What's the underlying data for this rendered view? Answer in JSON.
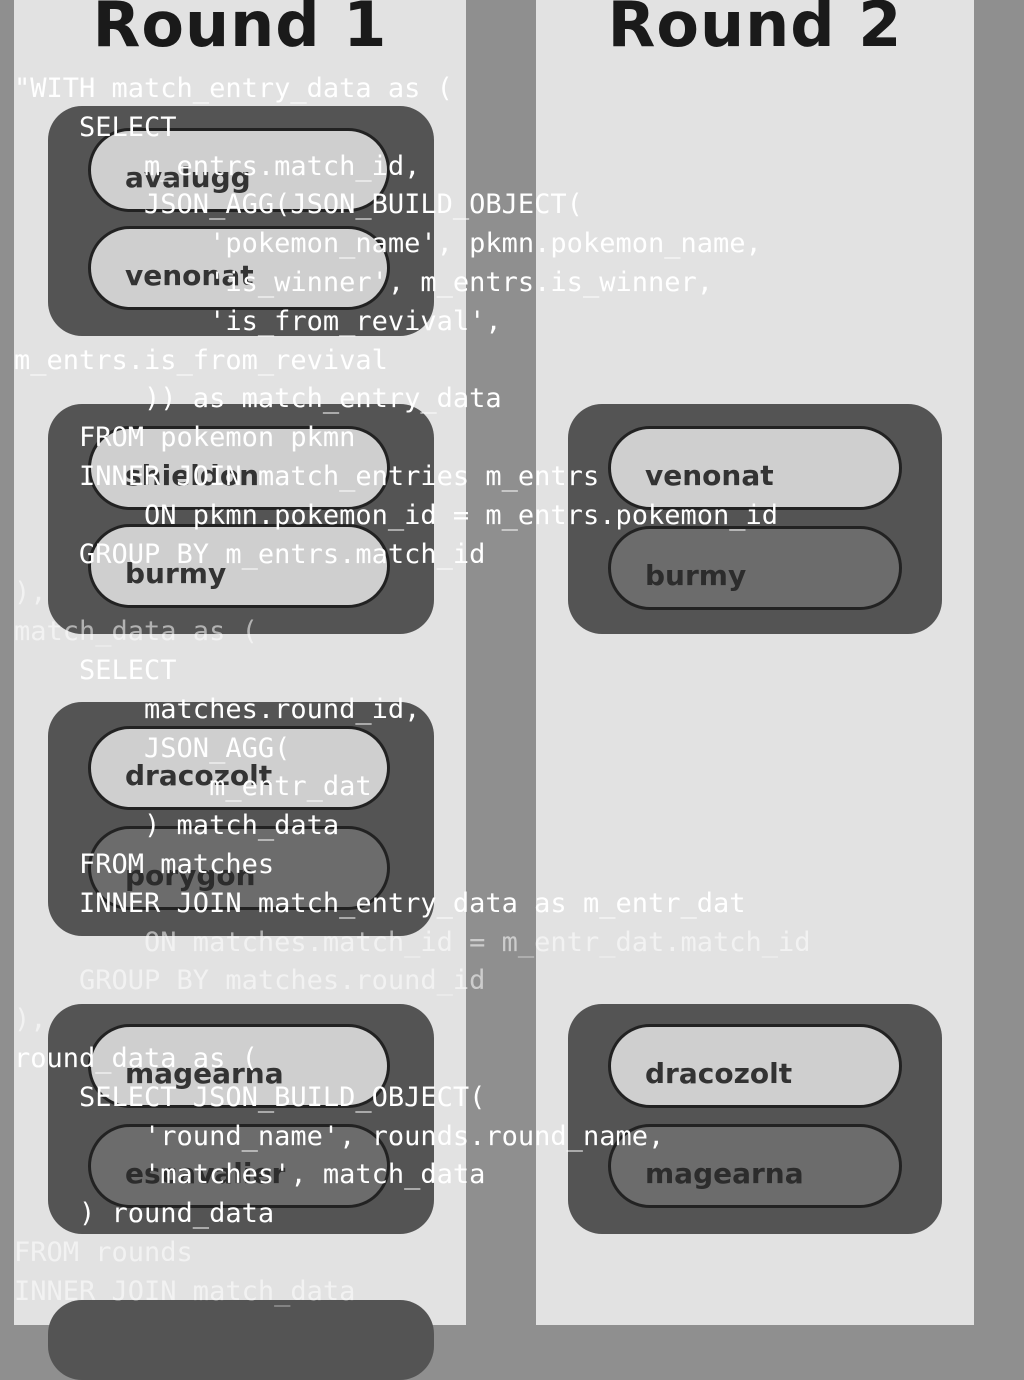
{
  "rounds": [
    {
      "title": "Round 1",
      "matches": [
        {
          "entries": [
            {
              "name": "avalugg",
              "result": "winner"
            },
            {
              "name": "venonat",
              "result": "winner"
            }
          ]
        },
        {
          "entries": [
            {
              "name": "shieldon",
              "result": "winner"
            },
            {
              "name": "burmy",
              "result": "winner"
            }
          ]
        },
        {
          "entries": [
            {
              "name": "dracozolt",
              "result": "winner"
            },
            {
              "name": "porygon",
              "result": "loser"
            }
          ]
        },
        {
          "entries": [
            {
              "name": "magearna",
              "result": "winner"
            },
            {
              "name": "escavalier",
              "result": "loser"
            }
          ]
        }
      ]
    },
    {
      "title": "Round 2",
      "matches": [
        {
          "entries": [
            {
              "name": "venonat",
              "result": "winner"
            },
            {
              "name": "burmy",
              "result": "loser"
            }
          ]
        },
        {
          "entries": [
            {
              "name": "dracozolt",
              "result": "winner"
            },
            {
              "name": "magearna",
              "result": "loser"
            }
          ]
        }
      ]
    }
  ],
  "sql_overlay": [
    "\"WITH match_entry_data as (",
    "    SELECT",
    "        m_entrs.match_id,",
    "        JSON_AGG(JSON_BUILD_OBJECT(",
    "            'pokemon_name', pkmn.pokemon_name,",
    "            'is_winner', m_entrs.is_winner,",
    "            'is_from_revival',",
    "m_entrs.is_from_revival",
    "        )) as match_entry_data",
    "    FROM pokemon pkmn",
    "    INNER JOIN match_entries m_entrs",
    "        ON pkmn.pokemon_id = m_entrs.pokemon_id",
    "    GROUP BY m_entrs.match_id",
    "),",
    "match_data as (",
    "    SELECT",
    "        matches.round_id,",
    "        JSON_AGG(",
    "            m_entr_dat",
    "        ) match_data",
    "    FROM matches",
    "    INNER JOIN match_entry_data as m_entr_dat",
    "        ON matches.match_id = m_entr_dat.match_id",
    "    GROUP BY matches.round_id",
    "),",
    "round_data as (",
    "    SELECT JSON_BUILD_OBJECT(",
    "        'round_name', rounds.round_name,",
    "        'matches', match_data",
    "    ) round_data",
    "FROM rounds",
    "INNER JOIN match_data"
  ],
  "colors": {
    "background": "#8f8f8f",
    "column": "#e2e2e2",
    "match_card": "#545454",
    "winner_pill": "#cfcfcf",
    "loser_pill": "#6c6c6c",
    "code_text": "#ffffff"
  }
}
